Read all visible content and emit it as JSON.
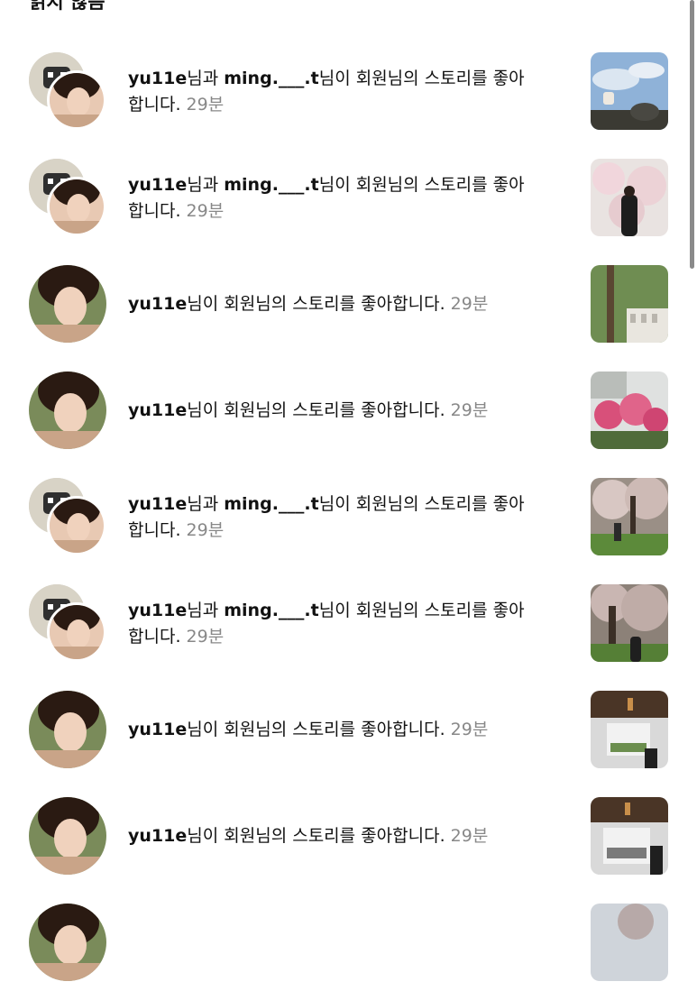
{
  "header": {
    "title": "읽지 않음"
  },
  "notifications": [
    {
      "user1": "yu11e",
      "conj": "님과 ",
      "user2": "ming.___.t",
      "action": "님이 회원님의 스토리를 좋아",
      "action2": "합니다. ",
      "time": "29분",
      "avatar": "double",
      "thumb": "sky-tree"
    },
    {
      "user1": "yu11e",
      "conj": "님과 ",
      "user2": "ming.___.t",
      "action": "님이 회원님의 스토리를 좋아",
      "action2": "합니다. ",
      "time": "29분",
      "avatar": "double",
      "thumb": "blossom-person"
    },
    {
      "user1": "yu11e",
      "action": "님이 회원님의 스토리를 좋아합니다. ",
      "time": "29분",
      "avatar": "single",
      "thumb": "tree-building"
    },
    {
      "user1": "yu11e",
      "action": "님이 회원님의 스토리를 좋아합니다. ",
      "time": "29분",
      "avatar": "single",
      "thumb": "pink-azalea"
    },
    {
      "user1": "yu11e",
      "conj": "님과 ",
      "user2": "ming.___.t",
      "action": "님이 회원님의 스토리를 좋아",
      "action2": "합니다. ",
      "time": "29분",
      "avatar": "double",
      "thumb": "blossom-lawn"
    },
    {
      "user1": "yu11e",
      "conj": "님과 ",
      "user2": "ming.___.t",
      "action": "님이 회원님의 스토리를 좋아",
      "action2": "합니다. ",
      "time": "29분",
      "avatar": "double",
      "thumb": "blossom-tree-person"
    },
    {
      "user1": "yu11e",
      "action": "님이 회원님의 스토리를 좋아합니다. ",
      "time": "29분",
      "avatar": "single",
      "thumb": "window-frame"
    },
    {
      "user1": "yu11e",
      "action": "님이 회원님의 스토리를 좋아합니다. ",
      "time": "29분",
      "avatar": "single",
      "thumb": "window-frame-2"
    },
    {
      "avatar": "single",
      "thumb": "partial"
    }
  ],
  "colors": {
    "text": "#111111",
    "time": "#888888",
    "background": "#ffffff"
  }
}
